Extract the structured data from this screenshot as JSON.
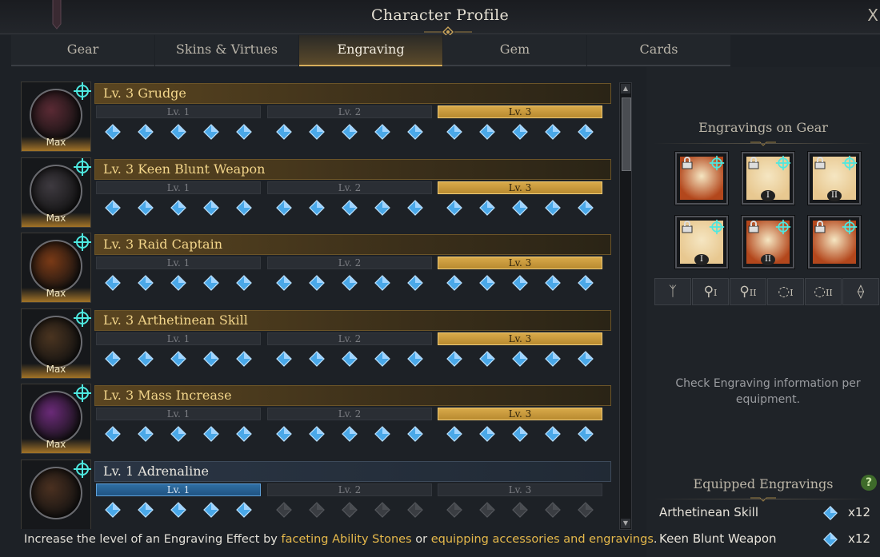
{
  "window": {
    "title": "Character Profile",
    "close": "X"
  },
  "tabs": [
    {
      "label": "Gear",
      "active": false
    },
    {
      "label": "Skins & Virtues",
      "active": false
    },
    {
      "label": "Engraving",
      "active": true
    },
    {
      "label": "Gem",
      "active": false
    },
    {
      "label": "Cards",
      "active": false
    }
  ],
  "level_labels": [
    "Lv. 1",
    "Lv. 2",
    "Lv. 3"
  ],
  "engravings": [
    {
      "name": "Lv. 3 Grudge",
      "badge": "Max",
      "level": 3,
      "filled_nodes": 15,
      "icon": "grudge-icon",
      "orb_color": "#5a2a34"
    },
    {
      "name": "Lv. 3 Keen Blunt Weapon",
      "badge": "Max",
      "level": 3,
      "filled_nodes": 15,
      "icon": "keen-blunt-weapon-icon",
      "orb_color": "#3e3a40"
    },
    {
      "name": "Lv. 3 Raid Captain",
      "badge": "Max",
      "level": 3,
      "filled_nodes": 15,
      "icon": "raid-captain-icon",
      "orb_color": "#7a3a16"
    },
    {
      "name": "Lv. 3 Arthetinean Skill",
      "badge": "Max",
      "level": 3,
      "filled_nodes": 15,
      "icon": "arthetinean-skill-icon",
      "orb_color": "#4a3420"
    },
    {
      "name": "Lv. 3 Mass Increase",
      "badge": "Max",
      "level": 3,
      "filled_nodes": 15,
      "icon": "mass-increase-icon",
      "orb_color": "#6a2a78"
    },
    {
      "name": "Lv. 1 Adrenaline",
      "badge": "",
      "level": 1,
      "filled_nodes": 5,
      "icon": "adrenaline-icon",
      "orb_color": "#4a3020"
    }
  ],
  "right_panel": {
    "gear_title": "Engravings on Gear",
    "gear_slots": [
      {
        "icon": "necklace-icon",
        "roman": "",
        "bg": "#b3471c"
      },
      {
        "icon": "earring-icon",
        "roman": "I",
        "bg": "#e8c890"
      },
      {
        "icon": "earring-icon",
        "roman": "II",
        "bg": "#e8c890"
      },
      {
        "icon": "ring-icon",
        "roman": "I",
        "bg": "#e8c890"
      },
      {
        "icon": "ring-icon",
        "roman": "II",
        "bg": "#b3471c"
      },
      {
        "icon": "ability-stone-icon",
        "roman": "",
        "bg": "#b3471c"
      }
    ],
    "filters": [
      {
        "icon": "necklace-filter-icon",
        "roman": ""
      },
      {
        "icon": "earring-filter-icon",
        "roman": "I"
      },
      {
        "icon": "earring-filter-icon",
        "roman": "II"
      },
      {
        "icon": "ring-filter-icon",
        "roman": "I"
      },
      {
        "icon": "ring-filter-icon",
        "roman": "II"
      },
      {
        "icon": "ability-stone-filter-icon",
        "roman": ""
      }
    ],
    "info": "Check Engraving information per equipment.",
    "equipped_title": "Equipped Engravings",
    "help": "?",
    "equipped": [
      {
        "name": "Arthetinean Skill",
        "count": "x12"
      },
      {
        "name": "Keen Blunt Weapon",
        "count": "x12"
      }
    ]
  },
  "footer": {
    "text1": "Increase the level of an Engraving Effect by ",
    "link1": "faceting Ability Stones",
    "text2": " or ",
    "link2": "equipping accessories and engravings",
    "text3": "."
  },
  "colors": {
    "accent_gold": "#d7ae5c",
    "node_blue": "#4aa8e8",
    "current_blue": "#2f6ea3"
  }
}
